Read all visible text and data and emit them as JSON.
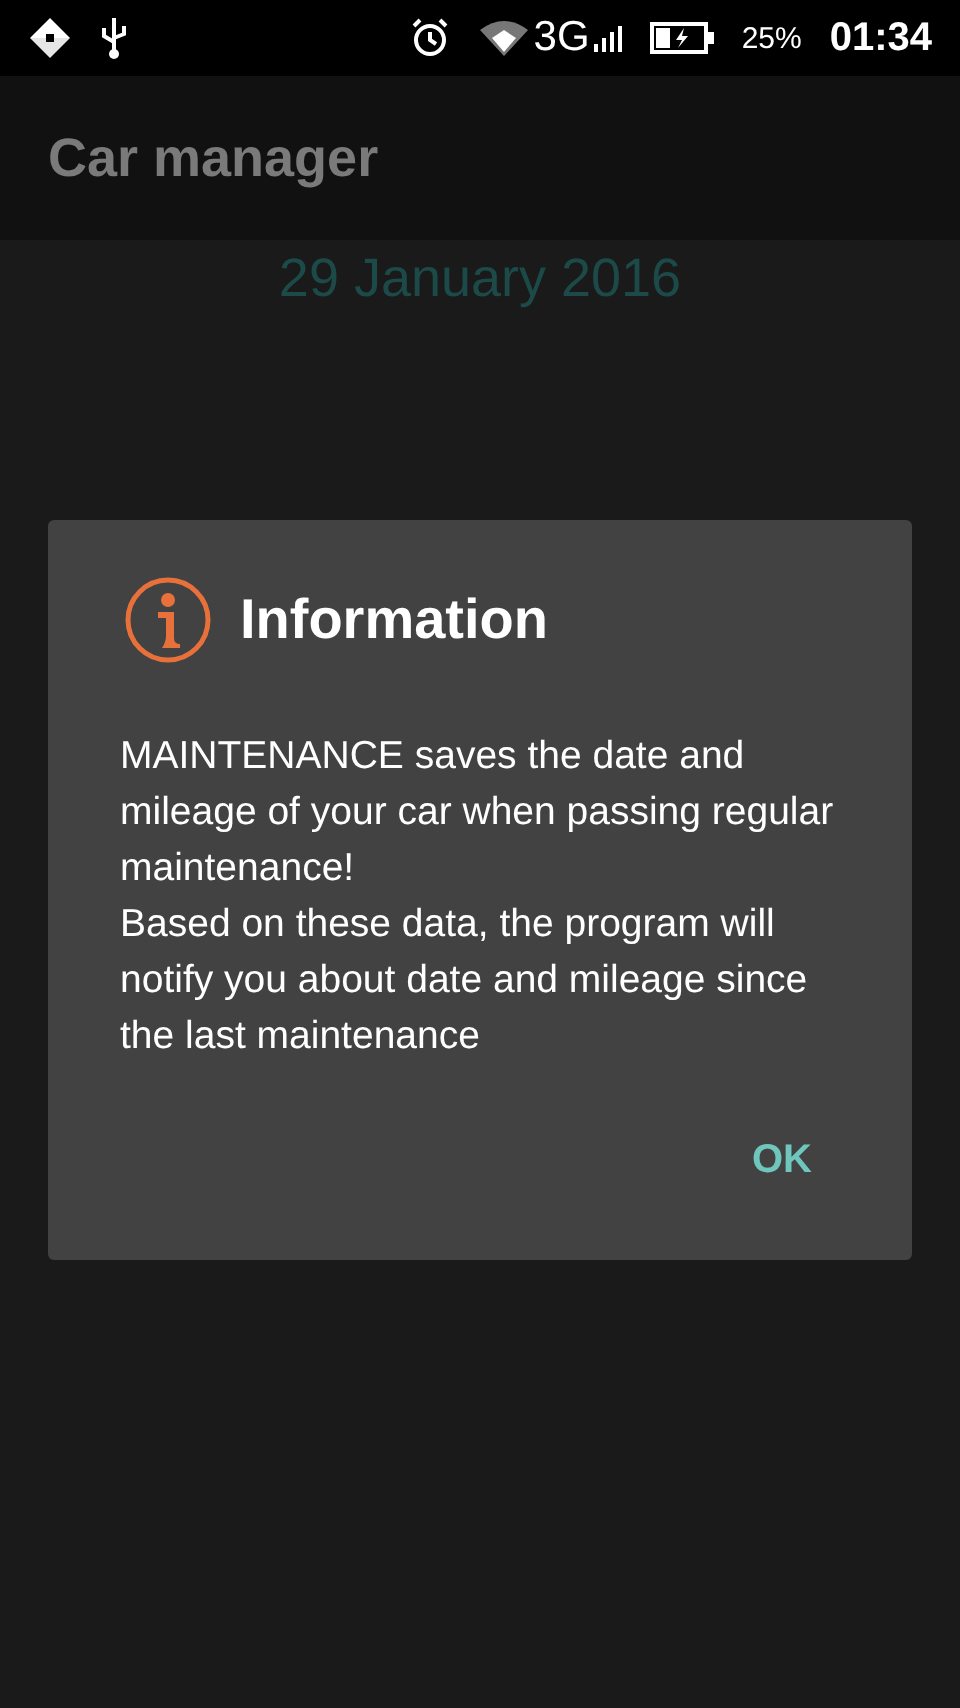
{
  "status_bar": {
    "network": "3G",
    "battery": "25%",
    "time": "01:34"
  },
  "app_bar": {
    "title": "Car manager"
  },
  "date": "29 January 2016",
  "dialog": {
    "title": "Information",
    "message": "MAINTENANCE saves the date and mileage of your car when passing regular maintenance!\n Based on these data, the program will notify you about date and mileage since the last maintenance",
    "buttons": [
      "OK"
    ]
  }
}
